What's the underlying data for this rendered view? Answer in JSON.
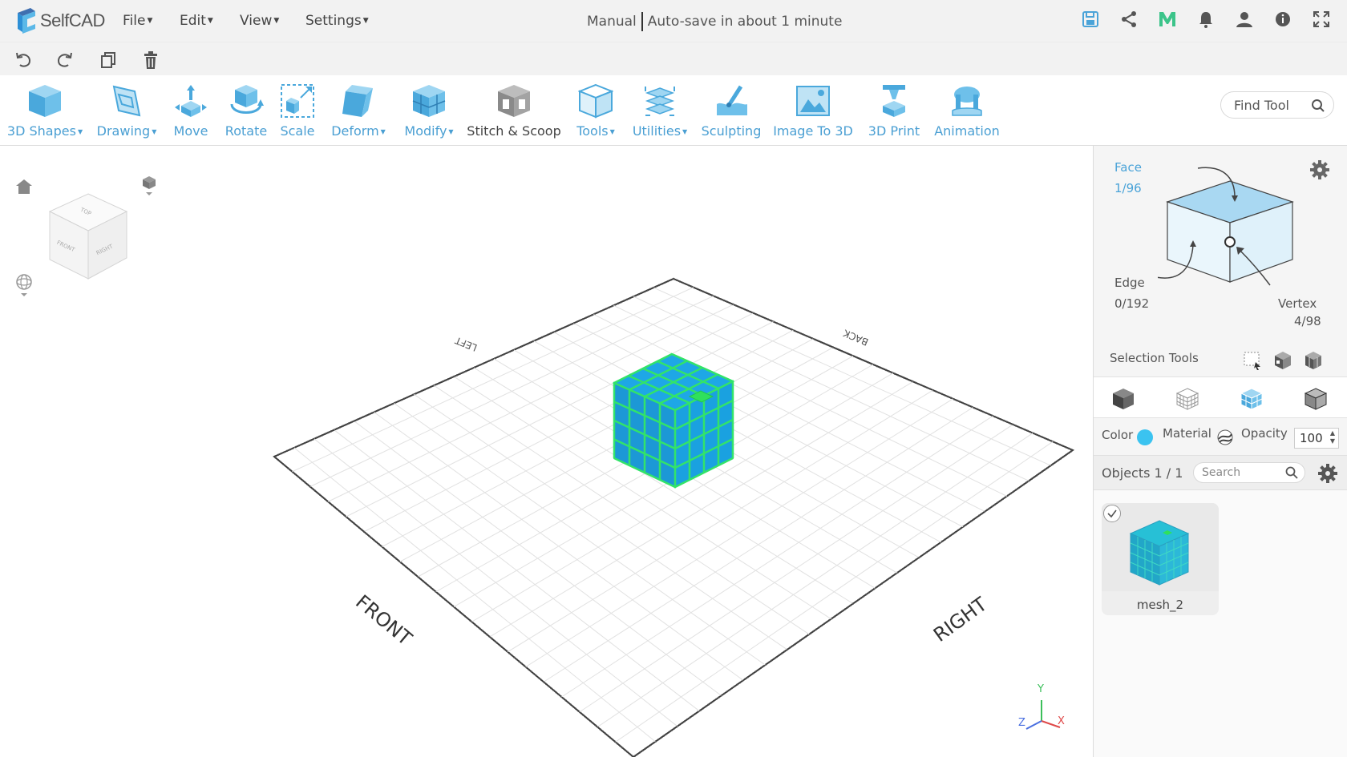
{
  "app": {
    "name": "SelfCAD",
    "menus": [
      {
        "label": "File"
      },
      {
        "label": "Edit"
      },
      {
        "label": "View"
      },
      {
        "label": "Settings"
      }
    ],
    "save_mode": "Manual",
    "autosave_status": "Auto-save in about 1 minute"
  },
  "top_icons": [
    "save-icon",
    "share-icon",
    "m-logo-icon",
    "bell-icon",
    "user-icon",
    "info-icon",
    "fullscreen-icon"
  ],
  "edit_icons": [
    "undo-icon",
    "redo-icon",
    "copy-icon",
    "delete-icon"
  ],
  "tools": [
    {
      "label": "3D Shapes",
      "dropdown": true
    },
    {
      "label": "Drawing",
      "dropdown": true
    },
    {
      "label": "Move",
      "dropdown": false
    },
    {
      "label": "Rotate",
      "dropdown": false
    },
    {
      "label": "Scale",
      "dropdown": false
    },
    {
      "label": "Deform",
      "dropdown": true
    },
    {
      "label": "Modify",
      "dropdown": true
    },
    {
      "label": "Stitch & Scoop",
      "dropdown": false
    },
    {
      "label": "Tools",
      "dropdown": true
    },
    {
      "label": "Utilities",
      "dropdown": true
    },
    {
      "label": "Sculpting",
      "dropdown": false
    },
    {
      "label": "Image To 3D",
      "dropdown": false
    },
    {
      "label": "3D Print",
      "dropdown": false
    },
    {
      "label": "Animation",
      "dropdown": false
    }
  ],
  "find_tool": {
    "placeholder": "Find Tool"
  },
  "viewport": {
    "view_cube": {
      "top": "TOP",
      "front": "FRONT",
      "right": "RIGHT"
    },
    "grid_labels": {
      "left": "LEFT",
      "back": "BACK",
      "front": "FRONT",
      "right": "RIGHT"
    },
    "axes": {
      "x": "X",
      "y": "Y",
      "z": "Z"
    },
    "colors": {
      "mesh_fill": "#1ea7e6",
      "mesh_edge": "#32e36a",
      "selected_face": "#2fe05c"
    }
  },
  "selection": {
    "face_label": "Face",
    "face_count": "1/96",
    "edge_label": "Edge",
    "edge_count": "0/192",
    "vertex_label": "Vertex",
    "vertex_count": "4/98",
    "tools_label": "Selection Tools"
  },
  "properties": {
    "color_label": "Color",
    "color_value": "#3bc3f0",
    "material_label": "Material",
    "opacity_label": "Opacity",
    "opacity_value": "100"
  },
  "objects": {
    "header": "Objects 1 / 1",
    "search_placeholder": "Search",
    "items": [
      {
        "name": "mesh_2"
      }
    ]
  }
}
